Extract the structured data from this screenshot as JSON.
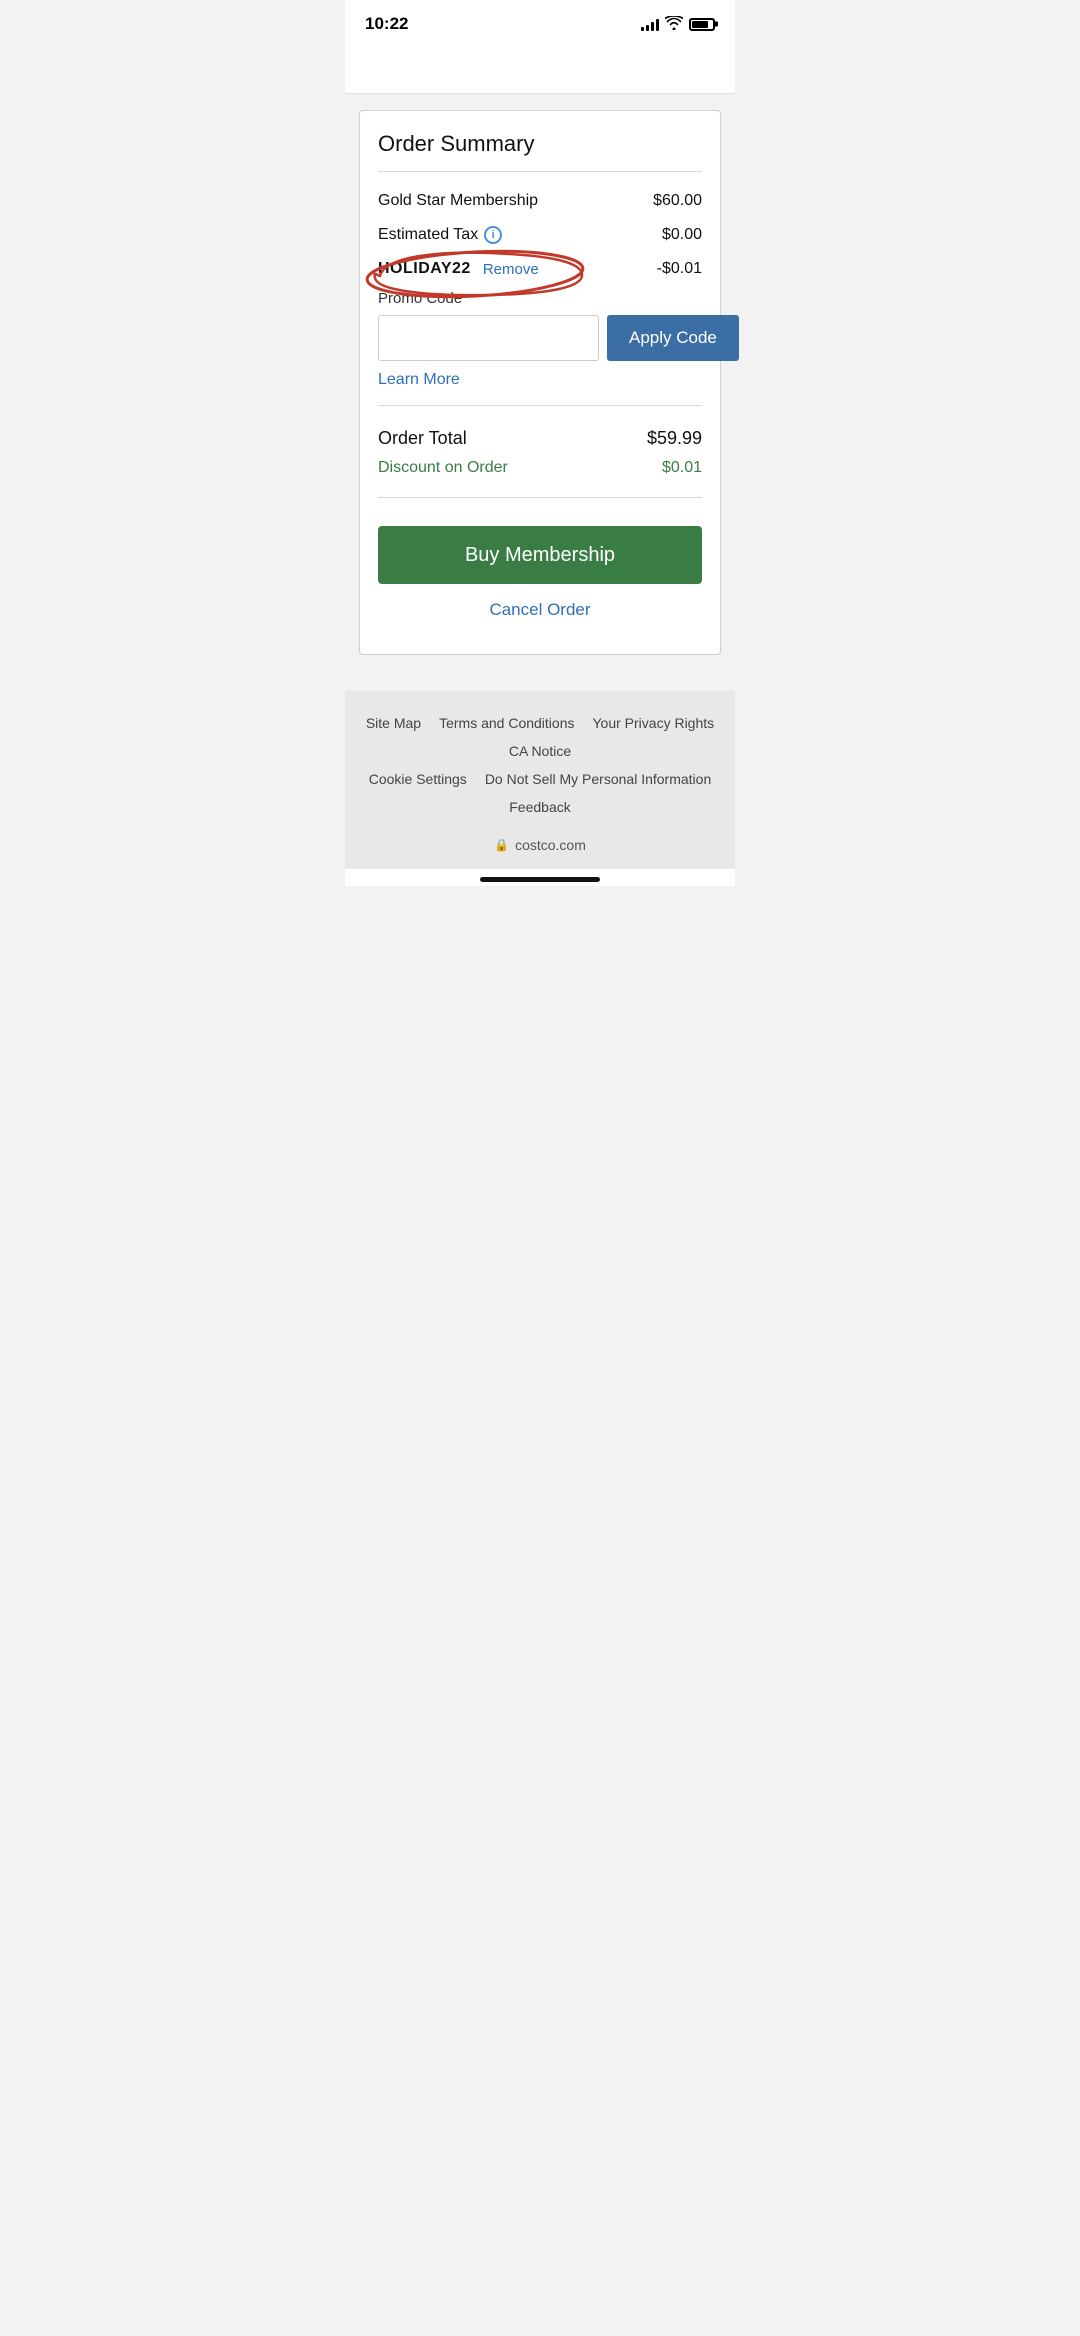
{
  "statusBar": {
    "time": "10:22"
  },
  "orderCard": {
    "title": "Order Summary",
    "lineItems": [
      {
        "label": "Gold Star Membership",
        "value": "$60.00",
        "hasInfo": false
      },
      {
        "label": "Estimated Tax",
        "value": "$0.00",
        "hasInfo": true
      },
      {
        "label": "HOLIDAY22",
        "value": "-$0.01",
        "hasRemove": true,
        "removeText": "Remove"
      }
    ],
    "promoSection": {
      "label": "Promo Code",
      "inputPlaceholder": "",
      "applyButtonLabel": "Apply Code",
      "learnMoreLabel": "Learn More"
    },
    "orderTotal": {
      "label": "Order Total",
      "value": "$59.99"
    },
    "discount": {
      "label": "Discount on Order",
      "value": "$0.01"
    },
    "buyButtonLabel": "Buy Membership",
    "cancelLabel": "Cancel Order"
  },
  "footer": {
    "links": [
      {
        "label": "Site Map"
      },
      {
        "label": "Terms and Conditions"
      },
      {
        "label": "Your Privacy Rights"
      }
    ],
    "links2": [
      {
        "label": "CA Notice"
      }
    ],
    "links3": [
      {
        "label": "Cookie Settings"
      },
      {
        "label": "Do Not Sell My Personal Information"
      }
    ],
    "links4": [
      {
        "label": "Feedback"
      }
    ],
    "domain": "costco.com"
  }
}
